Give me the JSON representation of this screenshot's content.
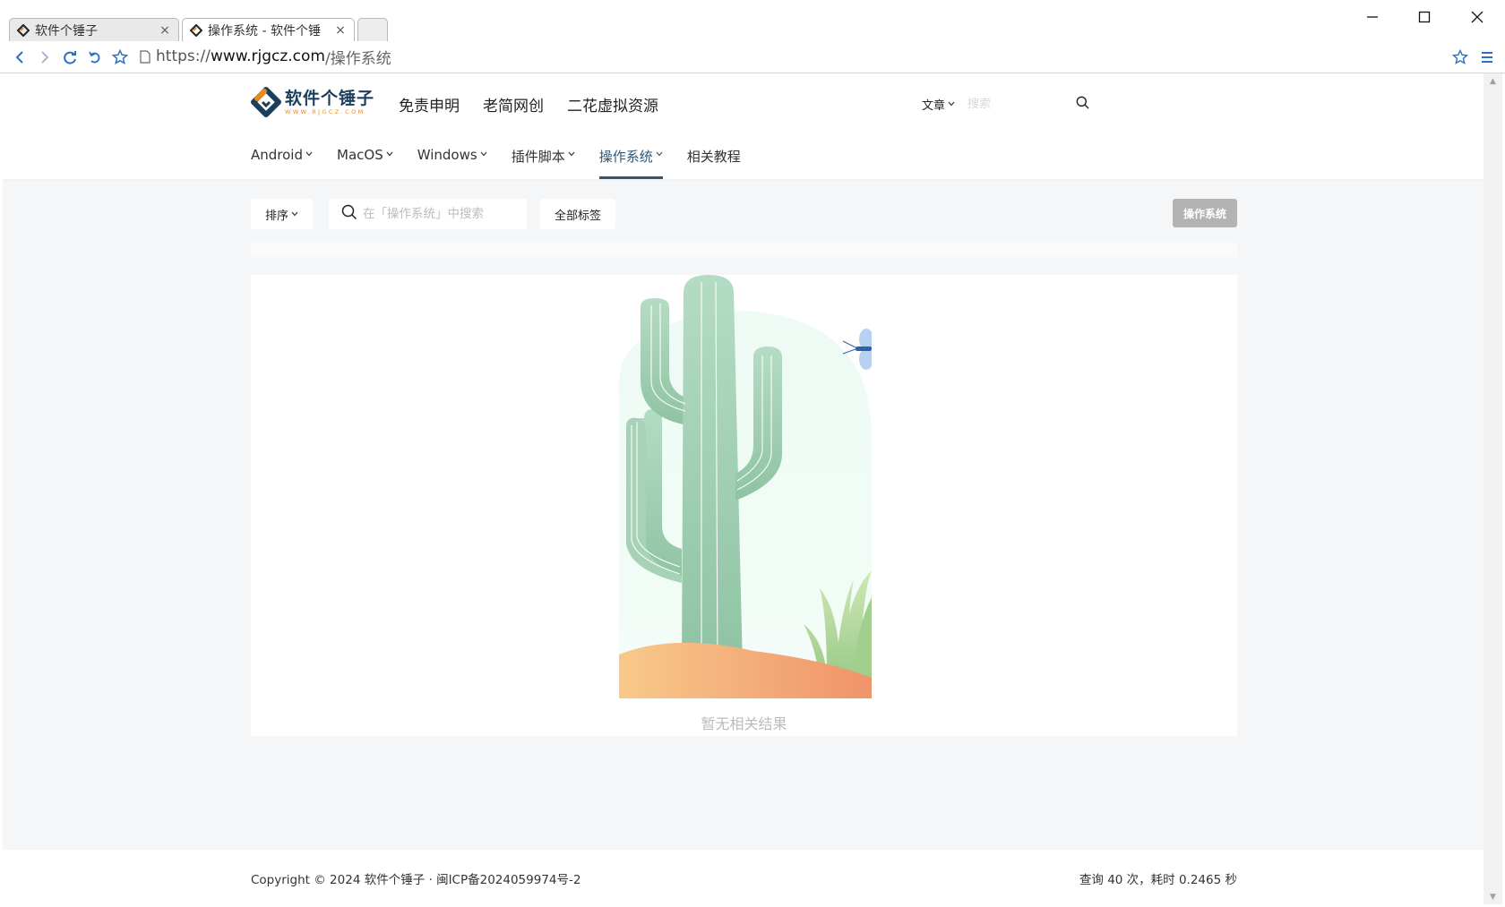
{
  "browser": {
    "tabs": [
      {
        "title": "软件个锤子",
        "active": false
      },
      {
        "title": "操作系统 - 软件个锤",
        "active": true
      }
    ],
    "close_glyph": "×",
    "url": {
      "protocol": "https://",
      "host": "www.rjgcz.com",
      "path": "/操作系统"
    },
    "window_controls": {
      "minimize": "—",
      "maximize": "☐",
      "close": "✕"
    }
  },
  "site": {
    "logo_text": "软件个锤子",
    "logo_subtext": "WWW.RJGCZ.COM",
    "top_nav": [
      "免责申明",
      "老简网创",
      "二花虚拟资源"
    ],
    "search_scope": "文章",
    "search_placeholder": "搜索",
    "categories": [
      {
        "label": "Android",
        "active": false
      },
      {
        "label": "MacOS",
        "active": false
      },
      {
        "label": "Windows",
        "active": false
      },
      {
        "label": "插件脚本",
        "active": false
      },
      {
        "label": "操作系统",
        "active": true
      },
      {
        "label": "相关教程",
        "active": false
      }
    ]
  },
  "filters": {
    "sort_label": "排序",
    "search_placeholder": "在「操作系统」中搜索",
    "all_tags_label": "全部标签",
    "current_tag": "操作系统"
  },
  "results": {
    "empty_text": "暂无相关结果"
  },
  "footer": {
    "copyright": "Copyright © 2024 软件个锤子 · 闽ICP备2024059974号-2",
    "stats": "查询 40 次，耗时 0.2465 秒"
  },
  "colors": {
    "accent": "#2f5878",
    "logo_blue": "#1a3e5c",
    "logo_orange": "#e48a1e",
    "page_bg": "#f5f6f8",
    "tag_button": "#b3b3b3",
    "muted_text": "#bcbcbc"
  },
  "icons": [
    "back-icon",
    "forward-icon",
    "refresh-icon",
    "undo-icon",
    "star-icon",
    "page-icon",
    "menu-icon",
    "search-icon",
    "chevron-down-icon"
  ]
}
